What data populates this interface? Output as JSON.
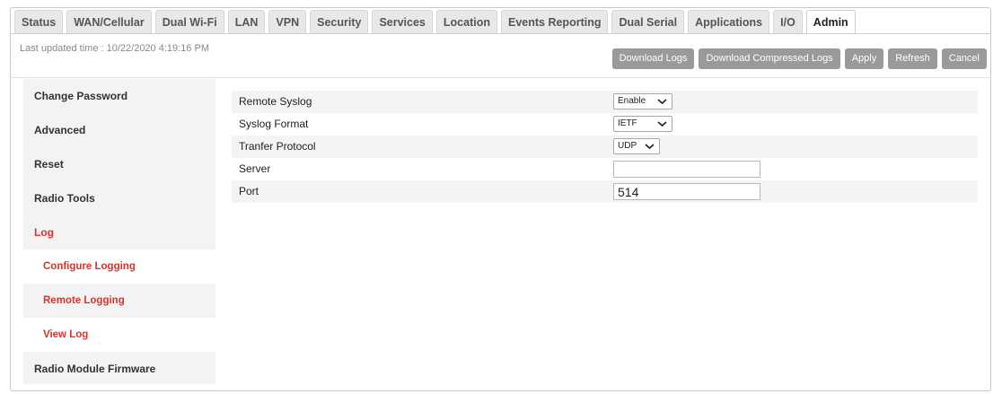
{
  "tabs": [
    {
      "label": "Status",
      "active": false
    },
    {
      "label": "WAN/Cellular",
      "active": false
    },
    {
      "label": "Dual Wi-Fi",
      "active": false
    },
    {
      "label": "LAN",
      "active": false
    },
    {
      "label": "VPN",
      "active": false
    },
    {
      "label": "Security",
      "active": false
    },
    {
      "label": "Services",
      "active": false
    },
    {
      "label": "Location",
      "active": false
    },
    {
      "label": "Events Reporting",
      "active": false
    },
    {
      "label": "Dual Serial",
      "active": false
    },
    {
      "label": "Applications",
      "active": false
    },
    {
      "label": "I/O",
      "active": false
    },
    {
      "label": "Admin",
      "active": true
    }
  ],
  "header": {
    "last_updated": "Last updated time : 10/22/2020 4:19:16 PM"
  },
  "actions": {
    "download_logs": "Download Logs",
    "download_compressed_logs": "Download Compressed Logs",
    "apply": "Apply",
    "refresh": "Refresh",
    "cancel": "Cancel"
  },
  "sidebar": {
    "items": [
      {
        "label": "Change Password"
      },
      {
        "label": "Advanced"
      },
      {
        "label": "Reset"
      },
      {
        "label": "Radio Tools"
      },
      {
        "label": "Log"
      },
      {
        "label": "Configure Logging"
      },
      {
        "label": "Remote Logging"
      },
      {
        "label": "View Log"
      },
      {
        "label": "Radio Module Firmware"
      }
    ]
  },
  "form": {
    "remote_syslog": {
      "label": "Remote Syslog",
      "value": "Enable"
    },
    "syslog_format": {
      "label": "Syslog Format",
      "value": "IETF"
    },
    "transfer_protocol": {
      "label": "Tranfer Protocol",
      "value": "UDP"
    },
    "server": {
      "label": "Server",
      "value": ""
    },
    "port": {
      "label": "Port",
      "value": "514"
    }
  },
  "colors": {
    "accent_red": "#d9342b",
    "button_gray": "#9a9a9a",
    "sidebar_bg": "#f3f3f3"
  },
  "icons": {
    "dropdown": "chevron-down-icon"
  }
}
